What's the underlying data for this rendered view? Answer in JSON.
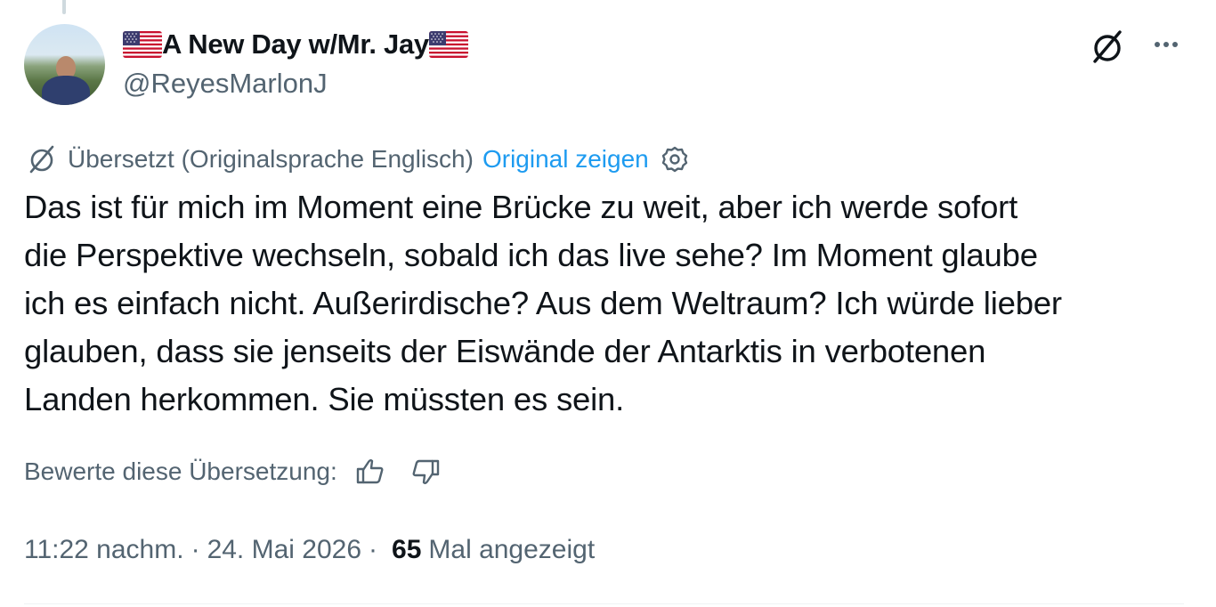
{
  "author": {
    "display_name": "A New Day w/Mr. Jay",
    "handle": "@ReyesMarlonJ"
  },
  "translation": {
    "notice": "Übersetzt (Originalsprache Englisch)",
    "show_original": "Original zeigen"
  },
  "tweet": {
    "text": "Das ist für mich im Moment eine Brücke zu weit, aber ich werde sofort\ndie Perspektive wechseln, sobald ich das live sehe? Im Moment glaube\nich es einfach nicht. Außerirdische? Aus dem Weltraum? Ich würde lieber\nglauben, dass sie jenseits der Eiswände der Antarktis in verbotenen\nLanden herkommen. Sie müssten es sein."
  },
  "rating": {
    "label": "Bewerte diese Übersetzung:"
  },
  "meta": {
    "time": "11:22 nachm.",
    "separator": "·",
    "date": "24. Mai 2026",
    "views_count": "65",
    "views_label": "Mal angezeigt"
  },
  "colors": {
    "text_primary": "#0f1419",
    "text_secondary": "#536471",
    "link": "#1d9bf0",
    "divider": "#eff3f4"
  },
  "icons": [
    "us-flag-emoji",
    "grok-icon",
    "more-icon",
    "translate-icon",
    "gear-icon",
    "thumbs-up-icon",
    "thumbs-down-icon"
  ]
}
